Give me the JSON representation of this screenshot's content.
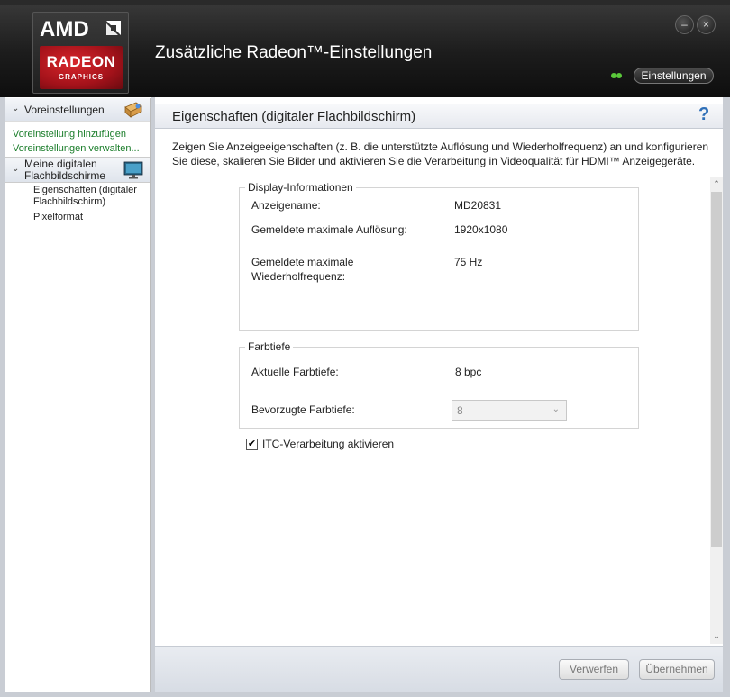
{
  "header": {
    "logo": {
      "amd": "AMD",
      "radeon": "RADEON",
      "graphics": "GRAPHICS"
    },
    "title": "Zusätzliche Radeon™-Einstellungen",
    "settings_button": "Einstellungen",
    "minimize_symbol": "–",
    "close_symbol": "×"
  },
  "sidebar": {
    "presets_section": {
      "label": "Voreinstellungen",
      "chevron": "⌄"
    },
    "links": [
      {
        "label": "Voreinstellung hinzufügen"
      },
      {
        "label": "Voreinstellungen verwalten..."
      }
    ],
    "flatpanel_section": {
      "label": "Meine digitalen Flachbildschirme",
      "chevron": "⌄"
    },
    "subitems": [
      {
        "label": "Eigenschaften (digitaler Flachbildschirm)"
      },
      {
        "label": "Pixelformat"
      }
    ]
  },
  "main": {
    "title": "Eigenschaften (digitaler Flachbildschirm)",
    "help": "?",
    "description": "Zeigen Sie Anzeigeeigenschaften (z. B. die unterstützte Auflösung und Wiederholfrequenz) an und konfigurieren Sie diese, skalieren Sie Bilder und aktivieren Sie die Verarbeitung in Videoqualität für HDMI™ Anzeigegeräte.",
    "display_info": {
      "legend": "Display-Informationen",
      "rows": [
        {
          "label": "Anzeigename:",
          "value": "MD20831"
        },
        {
          "label": "Gemeldete maximale Auflösung:",
          "value": "1920x1080"
        },
        {
          "label": "Gemeldete maximale Wiederholfrequenz:",
          "value": "75 Hz"
        }
      ]
    },
    "color_depth": {
      "legend": "Farbtiefe",
      "current_label": "Aktuelle Farbtiefe:",
      "current_value": "8 bpc",
      "preferred_label": "Bevorzugte Farbtiefe:",
      "preferred_value": "8",
      "preferred_arrow": "⌄"
    },
    "itc": {
      "label": "ITC-Verarbeitung aktivieren",
      "checked": true,
      "checkmark": "✔"
    },
    "scroll_up": "⌃",
    "scroll_down": "⌄"
  },
  "footer": {
    "discard_label": "Verwerfen",
    "apply_label": "Übernehmen"
  },
  "colors": {
    "accent_red": "#c8161d",
    "link_green": "#1a7d2a",
    "help_blue": "#2e6fb8"
  }
}
